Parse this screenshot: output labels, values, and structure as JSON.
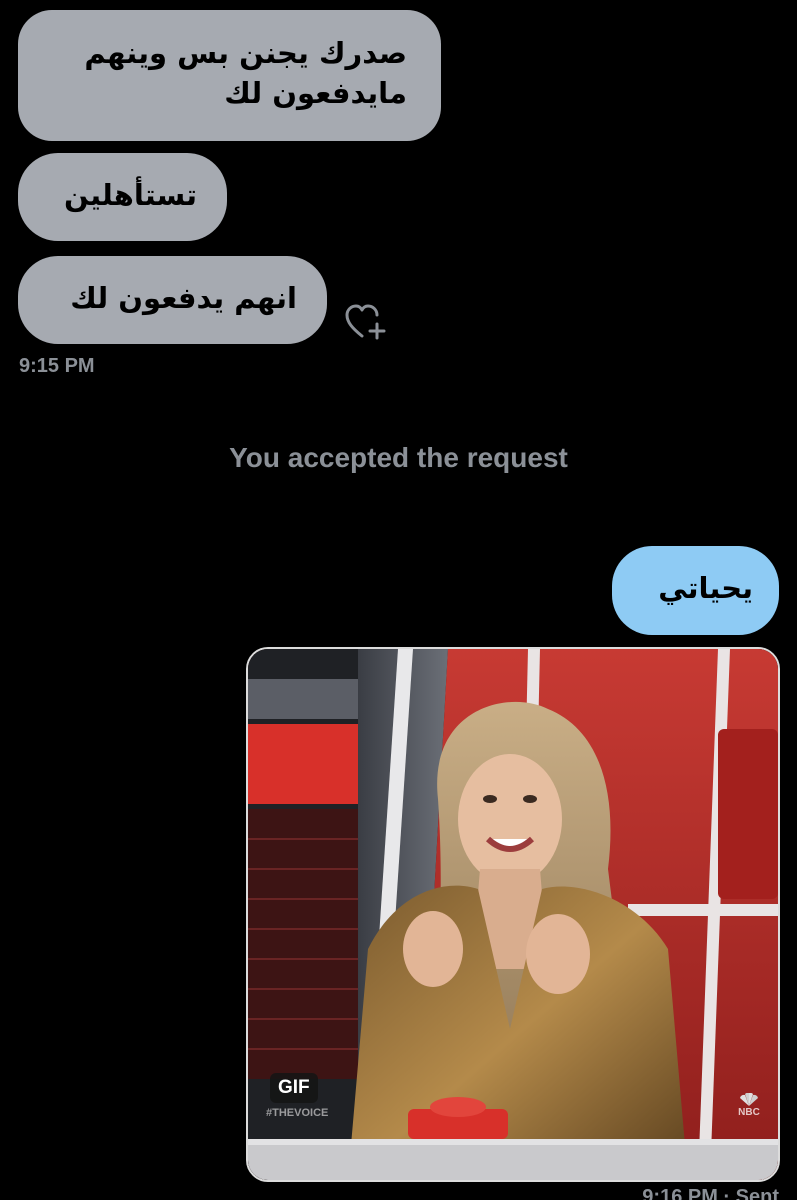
{
  "conversation": {
    "received_messages": [
      {
        "text": "صدرك يجنن بس وينهم مايدفعون لك"
      },
      {
        "text": "تستأهلين"
      },
      {
        "text": "انهم يدفعون لك"
      }
    ],
    "received_timestamp": "9:15 PM",
    "react_icon": "heart-plus-icon",
    "system_message": "You accepted the request",
    "sent_messages": [
      {
        "text": "يحياتي"
      }
    ],
    "gif": {
      "badge": "GIF",
      "hashtag": "#THEVOICE",
      "network": "NBC"
    },
    "sent_timestamp": "9:16 PM · Sent"
  },
  "colors": {
    "background": "#000000",
    "received_bubble": "#a6aab1",
    "sent_bubble": "#8ecbf4",
    "meta_text": "#8b9097"
  }
}
